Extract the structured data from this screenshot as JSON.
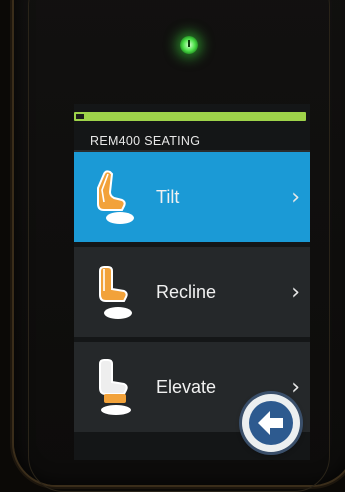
{
  "screen": {
    "title": "REM400 SEATING",
    "battery_level": 1.0,
    "battery_color": "#9ed34a"
  },
  "menu": {
    "items": [
      {
        "label": "Tilt",
        "icon": "seat-tilt-icon",
        "selected": true
      },
      {
        "label": "Recline",
        "icon": "seat-recline-icon",
        "selected": false
      },
      {
        "label": "Elevate",
        "icon": "seat-elevate-icon",
        "selected": false
      }
    ],
    "chevron": "›"
  },
  "colors": {
    "selected_row": "#1b9ad6",
    "row": "#25282a",
    "accent_seat": "#f2a23a",
    "power_led": "#4ee24a"
  },
  "hardware": {
    "power_icon": "power-icon",
    "back_icon": "back-arrow-icon"
  }
}
